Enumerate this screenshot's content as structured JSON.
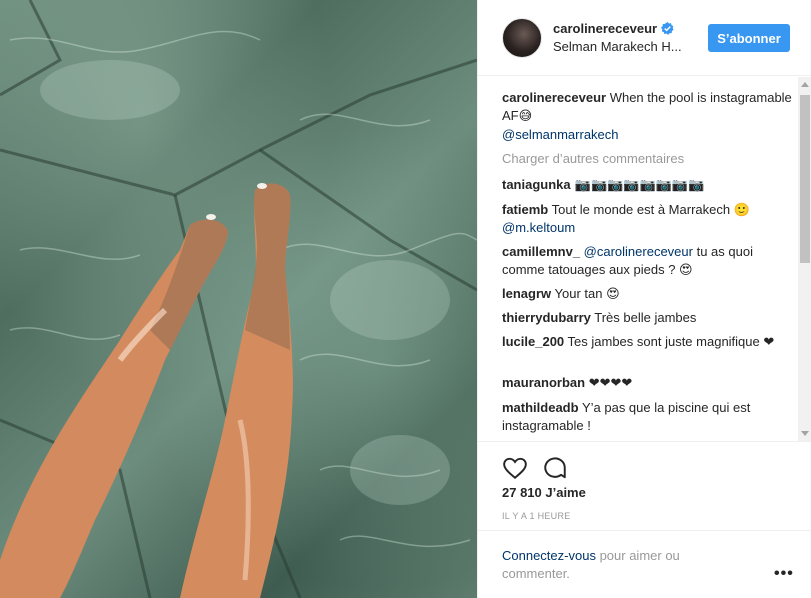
{
  "post": {
    "username": "carolinereceveur",
    "location": "Selman Marakech H...",
    "follow_label": "S’abonner",
    "caption_user": "carolinereceveur",
    "caption_text": " When the pool is instagramable AF",
    "caption_emoji": "😅",
    "caption_mention": "@selmanmarrakech",
    "load_more": "Charger d’autres commentaires",
    "likes": "27 810 J’aime",
    "time": "IL Y A 1 HEURE",
    "login_link": "Connectez-vous",
    "login_text": " pour aimer ou commenter.",
    "more": "•••"
  },
  "comments": [
    {
      "user": "taniagunka",
      "text": " 📷📷📷📷📷📷📷📷"
    },
    {
      "user": "fatiemb",
      "text": " Tout le monde est à Marrakech 🙂",
      "mention": "@m.keltoum"
    },
    {
      "user": "camillemnv_",
      "mention": "@carolinereceveur",
      "text": " tu as quoi comme tatouages aux pieds ? 😍"
    },
    {
      "user": "lenagrw",
      "text": " Your tan 😍"
    },
    {
      "user": "thierrydubarry",
      "text": " Très belle jambes"
    },
    {
      "user": "lucile_200",
      "text": " Tes jambes sont juste magnifique ❤"
    },
    {
      "user": "mauranorban",
      "text": " ❤❤❤❤"
    },
    {
      "user": "mathildeadb",
      "text": " Y’a pas que la piscine qui est instagramable !"
    }
  ],
  "colors": {
    "accent": "#3897f0",
    "link": "#003569",
    "muted": "#999999",
    "text": "#262626"
  },
  "icons": [
    "verified-badge-icon",
    "heart-icon",
    "comment-icon",
    "more-options-icon"
  ]
}
